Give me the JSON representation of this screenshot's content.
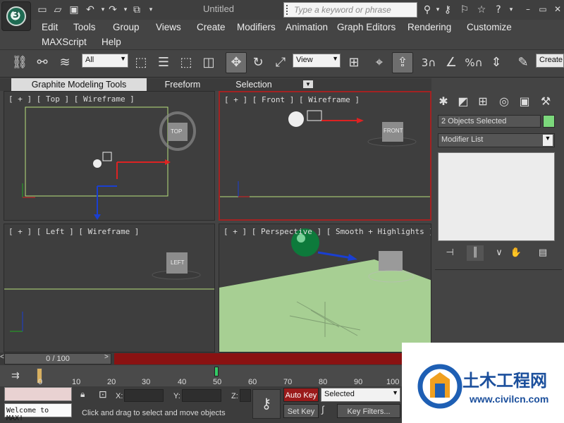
{
  "window": {
    "title": "Untitled"
  },
  "search": {
    "placeholder": "Type a keyword or phrase"
  },
  "menus": [
    "Edit",
    "Tools",
    "Group",
    "Views",
    "Create",
    "Modifiers",
    "Animation",
    "Graph Editors",
    "Rendering",
    "Customize",
    "MAXScript",
    "Help"
  ],
  "toolbar": {
    "selection_filter": "All",
    "reference_coord": "View",
    "create_label": "Create"
  },
  "ribbon": {
    "tabs": [
      "Graphite Modeling Tools",
      "Freeform",
      "Selection"
    ]
  },
  "viewports": {
    "top": {
      "label": "[ + ] [ Top ] [ Wireframe ]",
      "cube": "TOP"
    },
    "front": {
      "label": "[ + ] [ Front ] [ Wireframe ]",
      "cube": "FRONT"
    },
    "left": {
      "label": "[ + ] [ Left ] [ Wireframe ]",
      "cube": "LEFT"
    },
    "perspective": {
      "label": "[ + ] [ Perspective ] [ Smooth + Highlights ]"
    }
  },
  "command_panel": {
    "selection_status": "2 Objects Selected",
    "modifier_list": "Modifier List",
    "swatch_color": "#7cd87c"
  },
  "timeline": {
    "frame": "0 / 100",
    "ticks": [
      "0",
      "10",
      "20",
      "30",
      "40",
      "50",
      "60",
      "70",
      "80",
      "90",
      "100"
    ]
  },
  "status": {
    "listener_text": "Welcome to MAX!",
    "prompt": "Click and drag to select and move objects",
    "x_label": "X:",
    "y_label": "Y:",
    "z_label": "Z:",
    "auto_key": "Auto Key",
    "set_key": "Set Key",
    "key_mode": "Selected",
    "key_filters": "Key Filters..."
  },
  "watermark": {
    "site_cn": "土木工程网",
    "url": "www.civilcn.com"
  },
  "colors": {
    "accent_red": "#8a1212",
    "viewport_bg": "#3e3e3e",
    "ground_green": "#a7cf93"
  }
}
